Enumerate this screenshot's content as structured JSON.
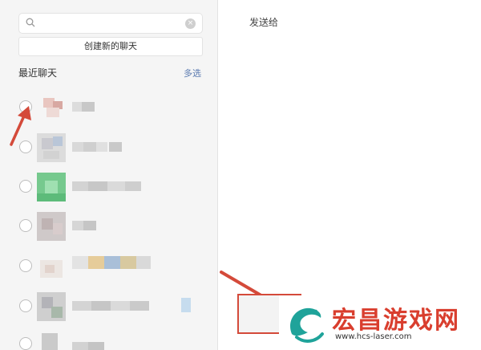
{
  "search": {
    "placeholder": "",
    "value": "",
    "clear_glyph": "×"
  },
  "create_chat_label": "创建新的聊天",
  "recent_chats": {
    "title": "最近聊天",
    "multi_select_label": "多选"
  },
  "right_panel": {
    "send_to_label": "发送给"
  },
  "watermark": {
    "title": "宏昌游戏网",
    "url": "www.hcs-laser.com"
  },
  "colors": {
    "accent": "#5a7ab0",
    "annotation_red": "#d44a3a",
    "brand_red": "#d93e2e",
    "brand_teal": "#1fa39a"
  },
  "icons": {
    "search": "search-icon",
    "clear": "clear-icon",
    "arrow": "red-arrow-icon"
  }
}
